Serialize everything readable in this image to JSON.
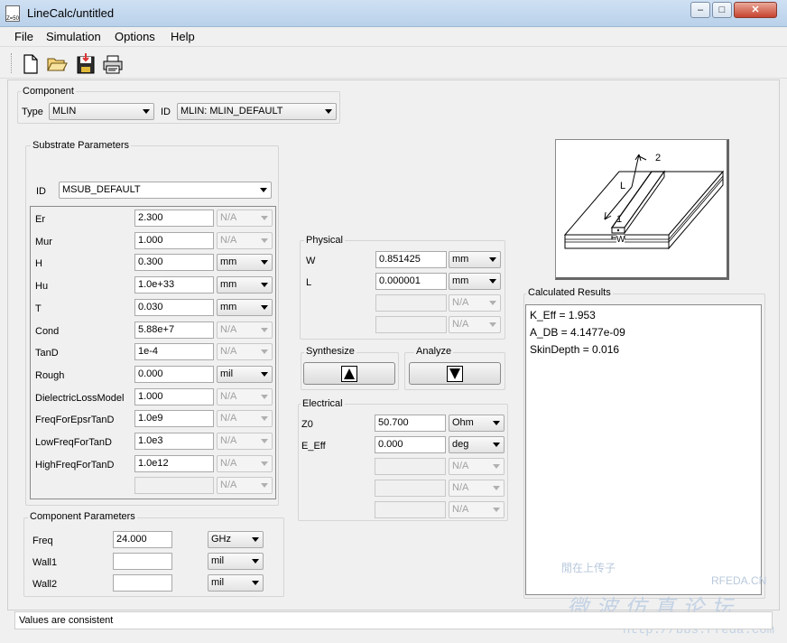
{
  "window": {
    "title": "LineCalc/untitled",
    "icon_text": "Z=50",
    "min_label": "–",
    "max_label": "□",
    "close_label": "✕"
  },
  "menu": {
    "items": [
      "File",
      "Simulation",
      "Options",
      "Help"
    ]
  },
  "toolbar": {
    "icons": [
      "new-file-icon",
      "open-folder-icon",
      "save-disk-icon",
      "print-icon"
    ]
  },
  "component": {
    "group_title": "Component",
    "type_label": "Type",
    "type_value": "MLIN",
    "id_label": "ID",
    "id_value": "MLIN: MLIN_DEFAULT"
  },
  "substrate": {
    "group_title": "Substrate Parameters",
    "id_label": "ID",
    "id_value": "MSUB_DEFAULT",
    "rows": [
      {
        "label": "Er",
        "value": "2.300",
        "unit": "N/A",
        "unit_enabled": false
      },
      {
        "label": "Mur",
        "value": "1.000",
        "unit": "N/A",
        "unit_enabled": false
      },
      {
        "label": "H",
        "value": "0.300",
        "unit": "mm",
        "unit_enabled": true
      },
      {
        "label": "Hu",
        "value": "1.0e+33",
        "unit": "mm",
        "unit_enabled": true
      },
      {
        "label": "T",
        "value": "0.030",
        "unit": "mm",
        "unit_enabled": true
      },
      {
        "label": "Cond",
        "value": "5.88e+7",
        "unit": "N/A",
        "unit_enabled": false
      },
      {
        "label": "TanD",
        "value": "1e-4",
        "unit": "N/A",
        "unit_enabled": false
      },
      {
        "label": "Rough",
        "value": "0.000",
        "unit": "mil",
        "unit_enabled": true
      },
      {
        "label": "DielectricLossModel",
        "value": "1.000",
        "unit": "N/A",
        "unit_enabled": false
      },
      {
        "label": "FreqForEpsrTanD",
        "value": "1.0e9",
        "unit": "N/A",
        "unit_enabled": false
      },
      {
        "label": "LowFreqForTanD",
        "value": "1.0e3",
        "unit": "N/A",
        "unit_enabled": false
      },
      {
        "label": "HighFreqForTanD",
        "value": "1.0e12",
        "unit": "N/A",
        "unit_enabled": false
      },
      {
        "label": "",
        "value": "",
        "unit": "N/A",
        "unit_enabled": false
      }
    ]
  },
  "component_params": {
    "group_title": "Component Parameters",
    "rows": [
      {
        "label": "Freq",
        "value": "24.000",
        "unit": "GHz"
      },
      {
        "label": "Wall1",
        "value": "",
        "unit": "mil"
      },
      {
        "label": "Wall2",
        "value": "",
        "unit": "mil"
      }
    ]
  },
  "physical": {
    "group_title": "Physical",
    "rows": [
      {
        "label": "W",
        "value": "0.851425",
        "unit": "mm",
        "enabled": true
      },
      {
        "label": "L",
        "value": "0.000001",
        "unit": "mm",
        "enabled": true
      },
      {
        "label": "",
        "value": "",
        "unit": "N/A",
        "enabled": false
      },
      {
        "label": "",
        "value": "",
        "unit": "N/A",
        "enabled": false
      }
    ]
  },
  "synthesize": {
    "group_title": "Synthesize",
    "arrow": "▲"
  },
  "analyze": {
    "group_title": "Analyze",
    "arrow": "▼"
  },
  "electrical": {
    "group_title": "Electrical",
    "rows": [
      {
        "label": "Z0",
        "value": "50.700",
        "unit": "Ohm",
        "enabled": true
      },
      {
        "label": "E_Eff",
        "value": "0.000",
        "unit": "deg",
        "enabled": true
      },
      {
        "label": "",
        "value": "",
        "unit": "N/A",
        "enabled": false
      },
      {
        "label": "",
        "value": "",
        "unit": "N/A",
        "enabled": false
      },
      {
        "label": "",
        "value": "",
        "unit": "N/A",
        "enabled": false
      }
    ]
  },
  "diagram": {
    "label_1": "1",
    "label_2": "2",
    "label_L": "L",
    "label_W": "W"
  },
  "results": {
    "group_title": "Calculated Results",
    "lines": [
      "K_Eff = 1.953",
      "A_DB = 4.1477e-09",
      "SkinDepth = 0.016"
    ]
  },
  "status": {
    "text": "Values are consistent"
  },
  "watermark": {
    "line1": "閒在上传子",
    "brand": "RFEDA.CN",
    "cn": "微波仿真论坛",
    "url": "http://bbs.rfeda.com"
  }
}
